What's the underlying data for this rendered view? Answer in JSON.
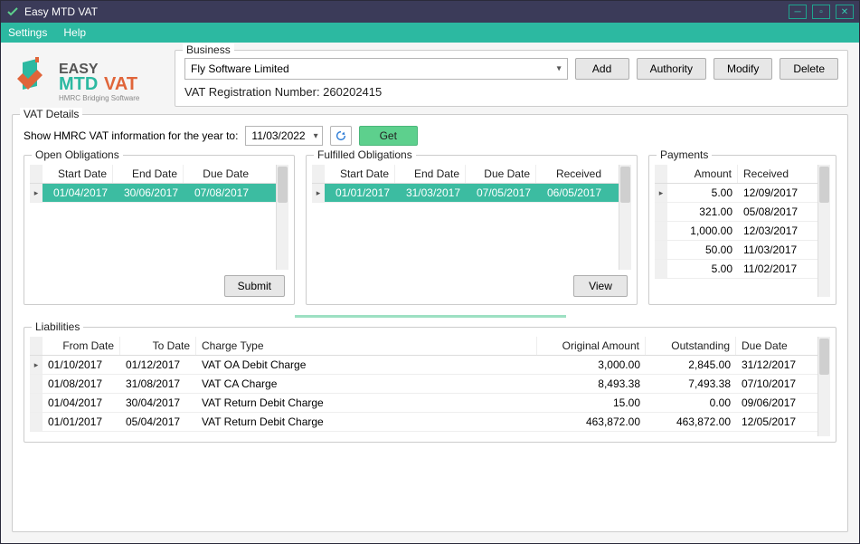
{
  "window": {
    "title": "Easy MTD VAT"
  },
  "menu": {
    "settings": "Settings",
    "help": "Help"
  },
  "logo": {
    "easy": "EASY",
    "mtd": "MTD",
    "vat": "VAT",
    "tag": "HMRC Bridging Software"
  },
  "business": {
    "label": "Business",
    "selected": "Fly Software Limited",
    "vat_reg": "VAT Registration Number: 260202415",
    "add": "Add",
    "authority": "Authority",
    "modify": "Modify",
    "delete": "Delete"
  },
  "vat": {
    "label": "VAT Details",
    "show_text": "Show HMRC VAT information for the year to:",
    "date": "11/03/2022",
    "get": "Get"
  },
  "open": {
    "label": "Open Obligations",
    "headers": {
      "start": "Start Date",
      "end": "End Date",
      "due": "Due Date"
    },
    "rows": [
      {
        "start": "01/04/2017",
        "end": "30/06/2017",
        "due": "07/08/2017"
      }
    ],
    "submit": "Submit"
  },
  "fulfilled": {
    "label": "Fulfilled Obligations",
    "headers": {
      "start": "Start Date",
      "end": "End Date",
      "due": "Due Date",
      "recv": "Received"
    },
    "rows": [
      {
        "start": "01/01/2017",
        "end": "31/03/2017",
        "due": "07/05/2017",
        "recv": "06/05/2017"
      }
    ],
    "view": "View"
  },
  "payments": {
    "label": "Payments",
    "headers": {
      "amount": "Amount",
      "recv": "Received"
    },
    "rows": [
      {
        "amount": "5.00",
        "recv": "12/09/2017"
      },
      {
        "amount": "321.00",
        "recv": "05/08/2017"
      },
      {
        "amount": "1,000.00",
        "recv": "12/03/2017"
      },
      {
        "amount": "50.00",
        "recv": "11/03/2017"
      },
      {
        "amount": "5.00",
        "recv": "11/02/2017"
      }
    ]
  },
  "liabilities": {
    "label": "Liabilities",
    "headers": {
      "from": "From Date",
      "to": "To Date",
      "charge": "Charge Type",
      "orig": "Original Amount",
      "out": "Outstanding",
      "due": "Due Date"
    },
    "rows": [
      {
        "from": "01/10/2017",
        "to": "01/12/2017",
        "charge": "VAT OA Debit Charge",
        "orig": "3,000.00",
        "out": "2,845.00",
        "due": "31/12/2017"
      },
      {
        "from": "01/08/2017",
        "to": "31/08/2017",
        "charge": "VAT CA Charge",
        "orig": "8,493.38",
        "out": "7,493.38",
        "due": "07/10/2017"
      },
      {
        "from": "01/04/2017",
        "to": "30/04/2017",
        "charge": "VAT Return Debit Charge",
        "orig": "15.00",
        "out": "0.00",
        "due": "09/06/2017"
      },
      {
        "from": "01/01/2017",
        "to": "05/04/2017",
        "charge": "VAT Return Debit Charge",
        "orig": "463,872.00",
        "out": "463,872.00",
        "due": "12/05/2017"
      }
    ]
  }
}
